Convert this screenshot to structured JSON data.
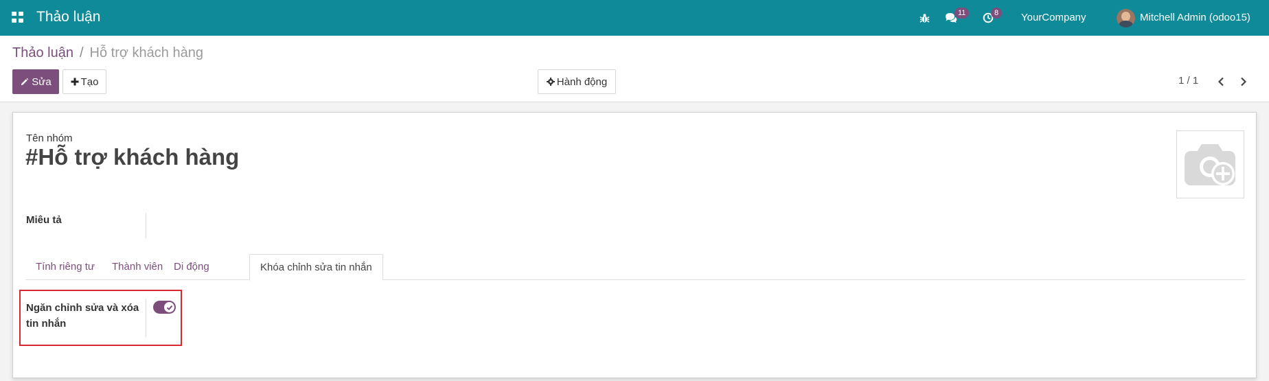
{
  "navbar": {
    "app_title": "Thảo luận",
    "messages_count": "11",
    "activities_count": "8",
    "company": "YourCompany",
    "user": "Mitchell Admin (odoo15)"
  },
  "breadcrumb": {
    "parent": "Thảo luận",
    "separator": "/",
    "current": "Hỗ trợ khách hàng"
  },
  "toolbar": {
    "edit_label": "Sửa",
    "create_label": "Tạo",
    "action_label": "Hành động"
  },
  "pager": {
    "value": "1 / 1"
  },
  "form": {
    "name_label": "Tên nhóm",
    "name_value": "#Hỗ trợ khách hàng",
    "description_label": "Miêu tả",
    "description_value": "",
    "tabs": [
      {
        "label": "Tính riêng tư"
      },
      {
        "label": "Thành viên"
      },
      {
        "label": "Di động"
      },
      {
        "label": "Khóa chỉnh sửa tin nhắn"
      }
    ],
    "active_tab_index": 3,
    "lock_field_label": "Ngăn chỉnh sửa và xóa tin nhắn",
    "lock_field_value": true
  },
  "colors": {
    "navbar": "#0f8a98",
    "primary": "#7b4e7c",
    "highlight": "#d9282f"
  },
  "icons": {
    "apps": "apps-grid-icon",
    "debug": "bug-icon",
    "messages": "chat-bubbles-icon",
    "activities": "clock-icon",
    "edit": "pencil-icon",
    "create": "plus-icon",
    "action": "gear-icon",
    "prev": "chevron-left-icon",
    "next": "chevron-right-icon",
    "image": "camera-plus-icon",
    "toggle_check": "check-icon"
  }
}
